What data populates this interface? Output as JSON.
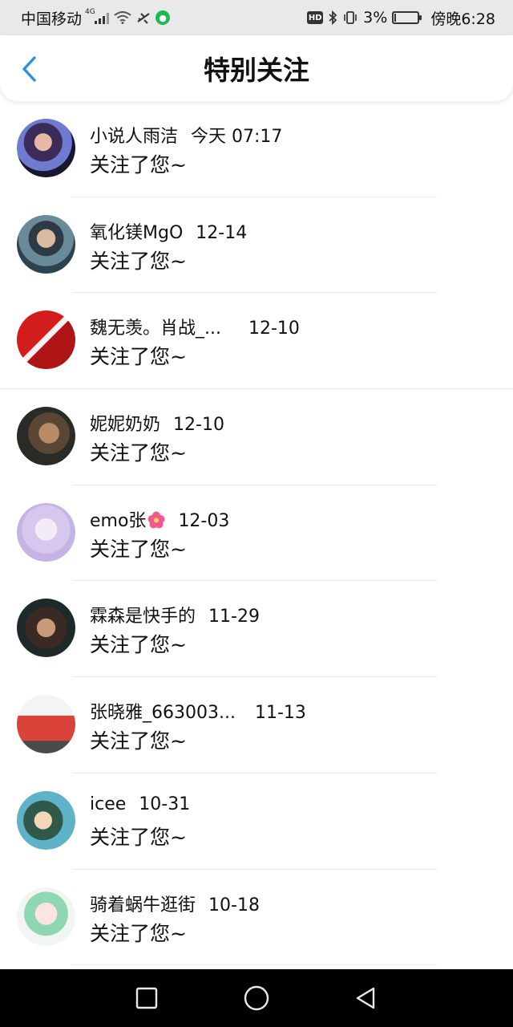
{
  "status_bar": {
    "carrier": "中国移动",
    "network": "4G",
    "battery": "3%",
    "time": "傍晚6:28",
    "battery_level": 0.03,
    "icons": [
      "signal-icon",
      "wifi-icon",
      "airplane-icon",
      "wechat-icon",
      "hd-icon",
      "bluetooth-icon",
      "vibrate-icon",
      "battery-icon"
    ]
  },
  "header": {
    "title": "特别关注",
    "back_icon": "chevron-left-icon",
    "accent": "#2f8fe6"
  },
  "list": [
    {
      "name": "小说人雨洁",
      "date": "今天 07:17",
      "message": "关注了您~"
    },
    {
      "name": "氧化镁MgO",
      "date": "12-14",
      "message": "关注了您~"
    },
    {
      "name": "魏无羡。肖战_...",
      "date": "12-10",
      "message": "关注了您~"
    },
    {
      "name": "妮妮奶奶",
      "date": "12-10",
      "message": "关注了您~"
    },
    {
      "name": "emo张",
      "date": "12-03",
      "message": "关注了您~",
      "emoji": "flower-icon"
    },
    {
      "name": "霖森是快手的",
      "date": "11-29",
      "message": "关注了您~"
    },
    {
      "name": "张晓雅_663003...",
      "date": "11-13",
      "message": "关注了您~"
    },
    {
      "name": "icee",
      "date": "10-31",
      "message": "关注了您~"
    },
    {
      "name": "骑着蜗牛逛街",
      "date": "10-18",
      "message": "关注了您~"
    }
  ],
  "nav_bar": {
    "icons": [
      "recent-apps-icon",
      "home-icon",
      "back-triangle-icon"
    ]
  }
}
